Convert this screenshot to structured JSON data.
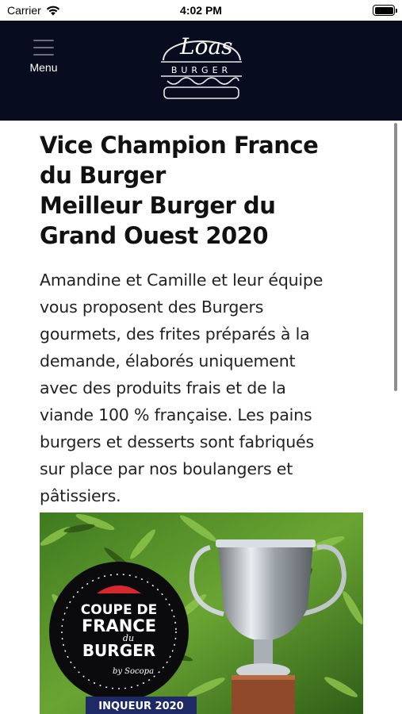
{
  "status": {
    "carrier": "Carrier",
    "time": "4:02 PM",
    "icons": [
      "wifi-icon",
      "battery-icon"
    ]
  },
  "header": {
    "menu_label": "Menu",
    "logo_script": "Loas",
    "logo_word": "BURGER"
  },
  "article": {
    "headline_lines": [
      "Vice Champion France",
      "du Burger",
      "Meilleur Burger du",
      "Grand Ouest 2020"
    ],
    "intro_lines": [
      "Amandine et Camille et leur équipe",
      "vous proposent des Burgers",
      "gourmets, des frites préparés à la",
      "demande, élaborés uniquement",
      "avec des produits frais et de la",
      "viande 100 % française. Les pains",
      "burgers et desserts sont fabriqués",
      "sur place par nos boulangers et",
      "pâtissiers."
    ]
  },
  "photo": {
    "plaque_lines": [
      "COUPE DE",
      "FRANCE",
      "du",
      "BURGER"
    ],
    "plaque_sub": "by Socopa",
    "ribbon": "VAINQUEUR 2020",
    "ribbon_visible": "INQUEUR 2020"
  },
  "colors": {
    "header_bg": "#070d1f",
    "text": "#111111",
    "foliage": "#4f8a2a"
  }
}
